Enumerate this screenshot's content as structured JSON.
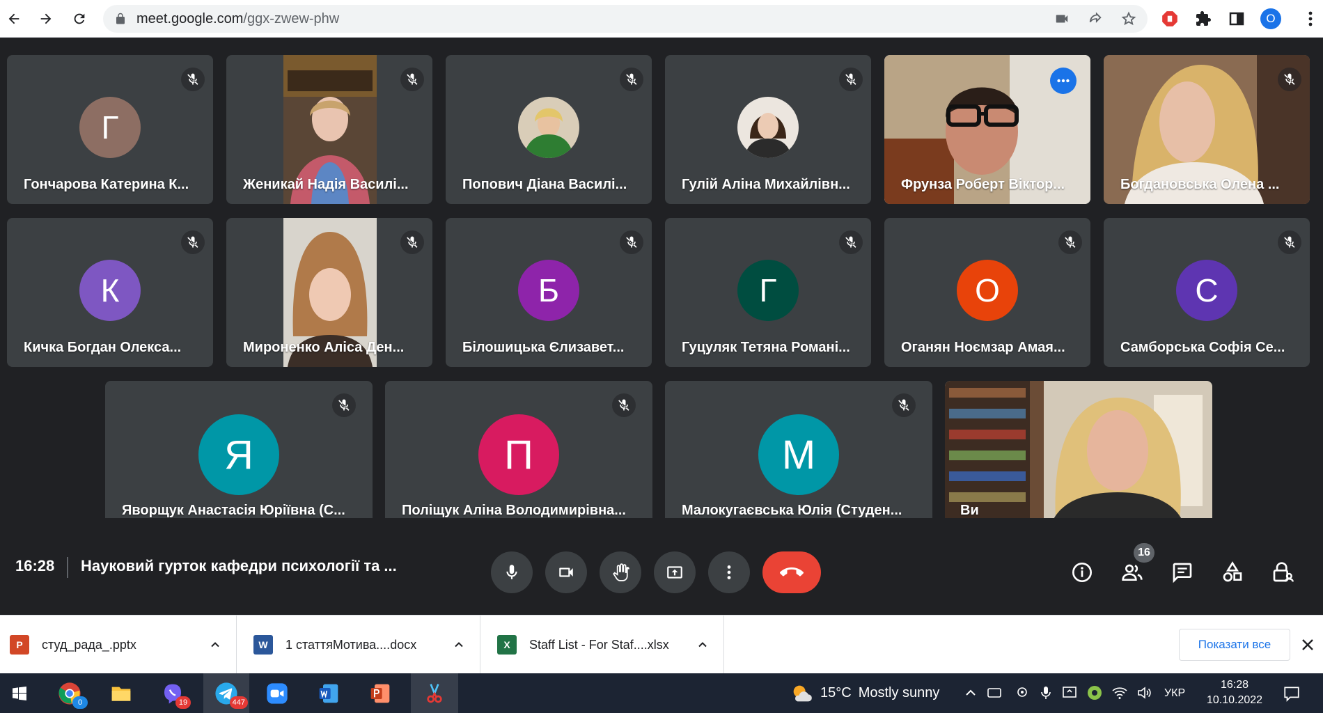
{
  "browser": {
    "url_host": "meet.google.com",
    "url_path": "/ggx-zwew-phw",
    "profile_initial": "O"
  },
  "participants": [
    {
      "name": "Гончарова Катерина К...",
      "initial": "Г",
      "avatar_color": "#8d6e63",
      "video": false
    },
    {
      "name": "Женикай Надія Василі...",
      "initial": "",
      "avatar_color": "",
      "video": true
    },
    {
      "name": "Попович Діана Василі...",
      "initial": "",
      "avatar_color": "",
      "video": false,
      "photo": true
    },
    {
      "name": "Гулій Аліна Михайлівн...",
      "initial": "",
      "avatar_color": "",
      "video": false,
      "photo": true
    },
    {
      "name": "Фрунза Роберт Віктор...",
      "initial": "",
      "avatar_color": "",
      "video": true,
      "active": true
    },
    {
      "name": "Богдановська Олена ...",
      "initial": "",
      "avatar_color": "",
      "video": true
    },
    {
      "name": "Кичка Богдан Олекса...",
      "initial": "К",
      "avatar_color": "#7e57c2",
      "video": false
    },
    {
      "name": "Мироненко Аліса Ден...",
      "initial": "",
      "avatar_color": "",
      "video": true
    },
    {
      "name": "Білошицька Єлизавет...",
      "initial": "Б",
      "avatar_color": "#8e24aa",
      "video": false
    },
    {
      "name": "Гуцуляк Тетяна Романі...",
      "initial": "Г",
      "avatar_color": "#004d40",
      "video": false
    },
    {
      "name": "Оганян Ноємзар Амая...",
      "initial": "О",
      "avatar_color": "#e8430a",
      "video": false
    },
    {
      "name": "Самборська Софія Се...",
      "initial": "С",
      "avatar_color": "#5e35b1",
      "video": false
    },
    {
      "name": "Яворщук Анастасія Юріївна (С...",
      "initial": "Я",
      "avatar_color": "#0097a7",
      "video": false
    },
    {
      "name": "Поліщук Аліна Володимирівна...",
      "initial": "П",
      "avatar_color": "#d81b60",
      "video": false
    },
    {
      "name": "Малокугаєвська Юлія (Студен...",
      "initial": "М",
      "avatar_color": "#0097a7",
      "video": false
    },
    {
      "name": "Ви",
      "initial": "",
      "avatar_color": "",
      "video": true,
      "self": true
    }
  ],
  "controls": {
    "time": "16:28",
    "meeting_title": "Науковий гурток кафедри психології та ...",
    "people_count": "16"
  },
  "downloads": [
    {
      "file": "студ_рада_.pptx",
      "type": "pptx",
      "color": "#d24726"
    },
    {
      "file": "1 статтяMотива....docx",
      "type": "docx",
      "color": "#2b579a"
    },
    {
      "file": "Staff List - For Staf....xlsx",
      "type": "xlsx",
      "color": "#217346"
    }
  ],
  "downloads_show_all": "Показати все",
  "taskbar": {
    "viber_badge": "19",
    "telegram_badge": "447",
    "chrome_badge": "0",
    "weather_temp": "15°C",
    "weather_text": "Mostly sunny",
    "language": "УКР",
    "time": "16:28",
    "date": "10.10.2022"
  },
  "colors": {
    "meet_bg": "#202124",
    "tile_bg": "#3c4043",
    "end_call": "#ea4335",
    "active_outline": "#8ab4f8"
  }
}
